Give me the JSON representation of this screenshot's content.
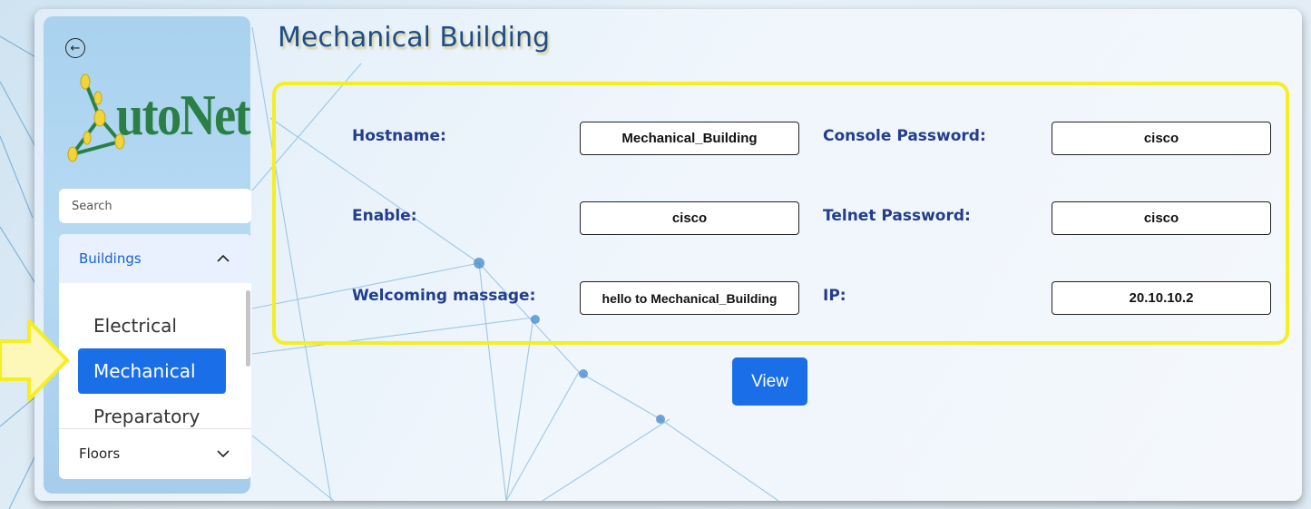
{
  "sidebar": {
    "back_icon": "arrow-left-circle-icon",
    "logo_text": "AutoNet",
    "logo_text_tail": "utoNet",
    "search": {
      "placeholder": "Search",
      "value": ""
    },
    "accordion": [
      {
        "label": "Buildings",
        "expanded": true,
        "items": [
          "Electrical",
          "Mechanical",
          "Preparatory"
        ],
        "selected": "Mechanical"
      },
      {
        "label": "Floors",
        "expanded": false
      }
    ]
  },
  "main": {
    "title": "Mechanical Building",
    "fields": {
      "hostname": {
        "label": "Hostname:",
        "value": "Mechanical_Building"
      },
      "console_password": {
        "label": "Console Password:",
        "value": "cisco"
      },
      "enable": {
        "label": "Enable:",
        "value": "cisco"
      },
      "telnet_password": {
        "label": "Telnet Password:",
        "value": "cisco"
      },
      "welcoming_message": {
        "label": "Welcoming massage:",
        "value": "hello to Mechanical_Building"
      },
      "ip": {
        "label": "IP:",
        "value": "20.10.10.2"
      }
    },
    "view_button": "View"
  },
  "colors": {
    "accent": "#1a6fe8",
    "highlight": "#f5ee20",
    "title": "#1f4e86",
    "label": "#233d8e",
    "logo": "#2a7f46"
  }
}
